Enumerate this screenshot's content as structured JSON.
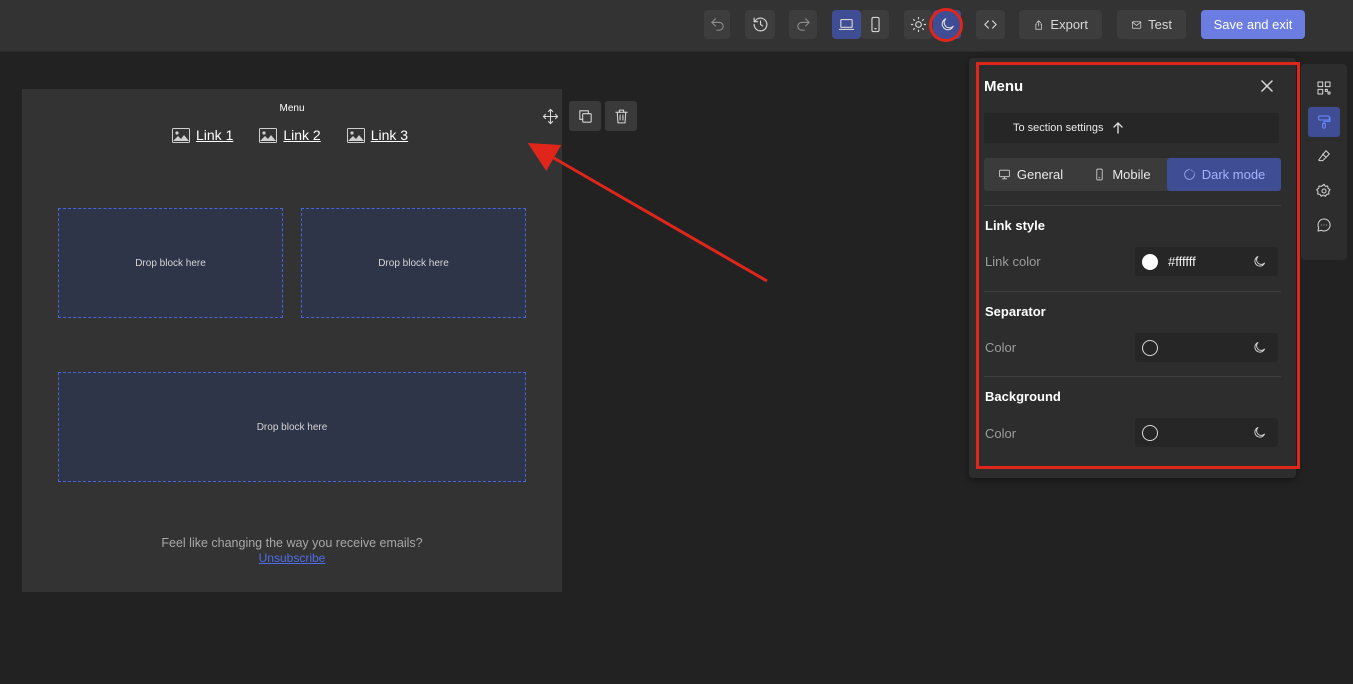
{
  "toolbar": {
    "export_label": "Export",
    "test_label": "Test",
    "save_exit_label": "Save and exit"
  },
  "email": {
    "menu_title": "Menu",
    "links": [
      "Link 1",
      "Link 2",
      "Link 3"
    ],
    "drop_zones": [
      "Drop block here",
      "Drop block here",
      "Drop block here"
    ],
    "footer_text": "Feel like changing the way you receive emails?",
    "unsubscribe_label": "Unsubscribe"
  },
  "panel": {
    "title": "Menu",
    "section_link": "To section settings",
    "tabs": [
      "General",
      "Mobile",
      "Dark mode"
    ],
    "active_tab": "Dark mode",
    "link_style_title": "Link style",
    "link_color_label": "Link color",
    "link_color_value": "#ffffff",
    "separator_title": "Separator",
    "separator_color_label": "Color",
    "background_title": "Background",
    "background_color_label": "Color"
  },
  "colors": {
    "accent": "#3f4d94",
    "primary_button": "#6b7de0",
    "annotation_red": "#e0261b",
    "drop_border": "#4a64d9",
    "link_blue": "#4d6ee8"
  },
  "icons": {
    "toolbar": [
      "undo-icon",
      "history-icon",
      "redo-icon",
      "laptop-icon",
      "mobile-icon",
      "sun-icon",
      "moon-icon",
      "code-icon",
      "export-icon",
      "mail-icon"
    ],
    "canvas_controls": [
      "move-icon",
      "duplicate-icon",
      "delete-icon"
    ],
    "rail": [
      "blocks-icon",
      "paint-roller-icon",
      "eraser-icon",
      "settings-gear-icon",
      "chat-icon"
    ]
  }
}
